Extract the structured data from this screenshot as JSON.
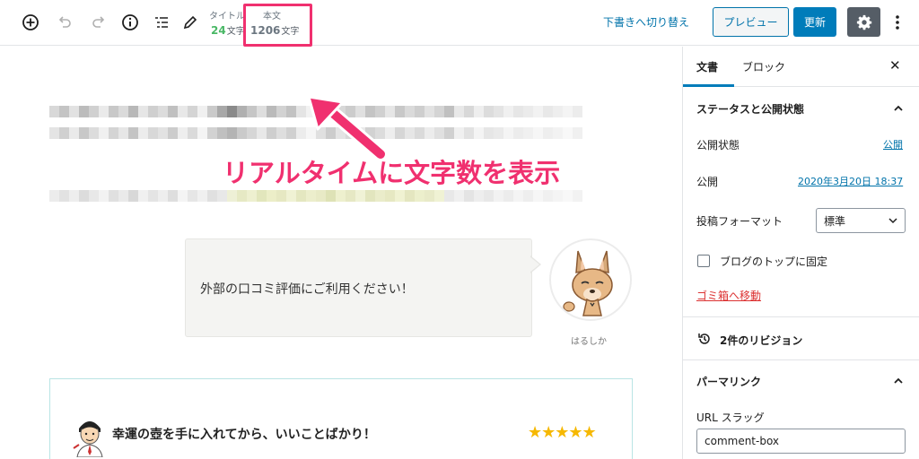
{
  "toolbar": {
    "title_counter_label": "タイトル",
    "title_count": "24",
    "title_count_unit": "文字",
    "body_counter_label": "本文",
    "body_count": "1206",
    "body_count_unit": "文字",
    "switch_to_draft": "下書きへ切り替え",
    "preview": "プレビュー",
    "update": "更新"
  },
  "editor": {
    "annotation": "リアルタイムに文字数を表示",
    "bubble_text": "外部の口コミ評価にご利用ください！",
    "avatar_name": "はるしか",
    "review_title": "幸運の壺を手に入れてから、いいことばかり！",
    "stars": "★★★★★",
    "rating": 5
  },
  "sidebar": {
    "tabs": [
      "文書",
      "ブロック"
    ],
    "close": "✕",
    "status_section": "ステータスと公開状態",
    "visibility_label": "公開状態",
    "visibility_value": "公開",
    "publish_label": "公開",
    "publish_value": "2020年3月20日 18:37",
    "format_label": "投稿フォーマット",
    "format_value": "標準",
    "sticky_label": "ブログのトップに固定",
    "trash": "ゴミ箱へ移動",
    "revisions": "2件のリビジョン",
    "permalink_section": "パーマリンク",
    "url_slug_label": "URL スラッグ",
    "url_slug_value": "comment-box"
  },
  "colors": {
    "accent": "#007cba",
    "highlight": "#f0306f",
    "green_count": "#4ab866",
    "star": "#f6b800",
    "danger": "#dc3232"
  }
}
